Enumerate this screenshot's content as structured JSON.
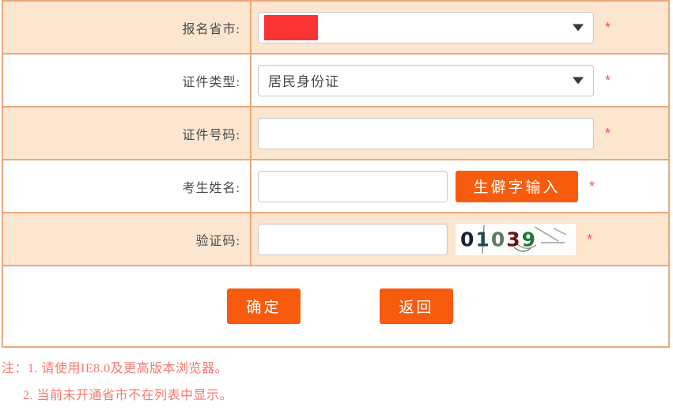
{
  "form": {
    "rows": [
      {
        "label": "报名省市:",
        "type": "select-redacted",
        "value": "",
        "required_marker": "*"
      },
      {
        "label": "证件类型:",
        "type": "select",
        "value": "居民身份证",
        "required_marker": "*"
      },
      {
        "label": "证件号码:",
        "type": "text",
        "value": "",
        "placeholder": "",
        "required_marker": "*"
      },
      {
        "label": "考生姓名:",
        "type": "text-with-button",
        "value": "",
        "placeholder": "",
        "button_label": "生僻字输入",
        "required_marker": "*"
      },
      {
        "label": "验证码:",
        "type": "text-with-captcha",
        "value": "",
        "placeholder": "",
        "required_marker": "*"
      }
    ],
    "captcha": {
      "text": "01039",
      "characters": [
        {
          "char": "0",
          "color": "#16213f"
        },
        {
          "char": "1",
          "color": "#1d4a52"
        },
        {
          "char": "0",
          "color": "#5c7b69"
        },
        {
          "char": "3",
          "color": "#6b0f17"
        },
        {
          "char": "9",
          "color": "#1f7a35"
        }
      ]
    },
    "actions": {
      "confirm_label": "确定",
      "back_label": "返回"
    },
    "notes": {
      "prefix": "注：",
      "line1": "1. 请使用IE8.0及更高版本浏览器。",
      "line2": "2. 当前未开通省市不在列表中显示。"
    }
  },
  "colors": {
    "accent_orange": "#f75c0e",
    "border_tan": "#eba87d",
    "row_peach": "#fce6d0",
    "required_red": "#f4564f",
    "note_red": "#f8776f",
    "redaction_red": "#fa3434"
  }
}
